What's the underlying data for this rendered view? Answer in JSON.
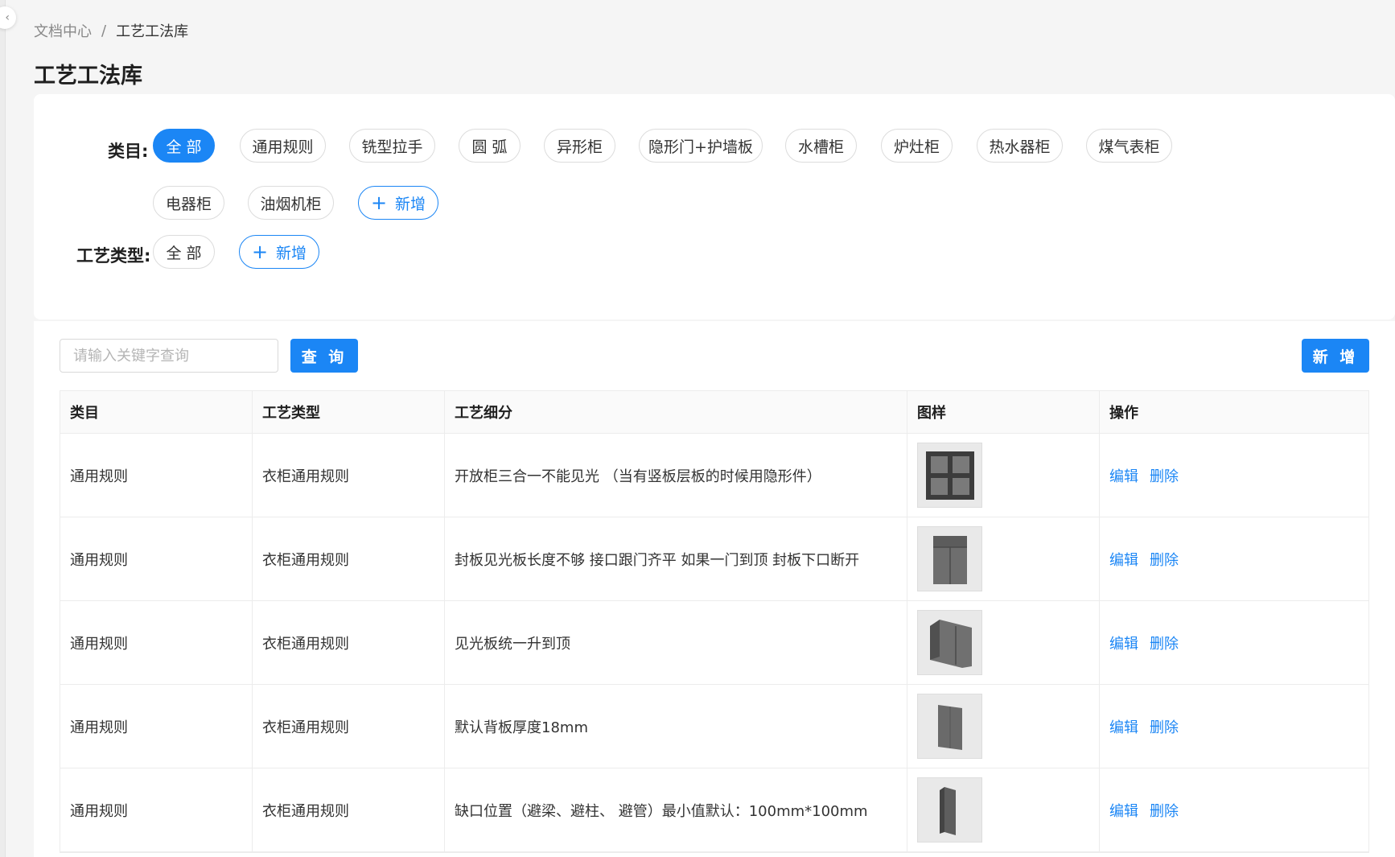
{
  "breadcrumb": {
    "root": "文档中心",
    "separator": "/",
    "current": "工艺工法库"
  },
  "page_title": "工艺工法库",
  "filters": {
    "category_label": "类目:",
    "categories": [
      "全 部",
      "通用规则",
      "铣型拉手",
      "圆 弧",
      "异形柜",
      "隐形门+护墙板",
      "水槽柜",
      "炉灶柜",
      "热水器柜",
      "煤气表柜",
      "电器柜",
      "油烟机柜"
    ],
    "category_add": "新增",
    "type_label": "工艺类型:",
    "types": [
      "全 部"
    ],
    "type_add": "新增"
  },
  "search": {
    "placeholder": "请输入关键字查询",
    "query_button": "查 询",
    "add_button": "新 增"
  },
  "table": {
    "columns": [
      "类目",
      "工艺类型",
      "工艺细分",
      "图样",
      "操作"
    ],
    "rows": [
      {
        "category": "通用规则",
        "type": "衣柜通用规则",
        "detail": "开放柜三合一不能见光 （当有竖板层板的时候用隐形件）",
        "image": "open-cabinet",
        "edit": "编辑",
        "delete": "删除"
      },
      {
        "category": "通用规则",
        "type": "衣柜通用规则",
        "detail": "封板见光板长度不够 接口跟门齐平 如果一门到顶 封板下口断开",
        "image": "tall-wardrobe",
        "edit": "编辑",
        "delete": "删除"
      },
      {
        "category": "通用规则",
        "type": "衣柜通用规则",
        "detail": "见光板统一升到顶",
        "image": "side-panel-cabinet",
        "edit": "编辑",
        "delete": "删除"
      },
      {
        "category": "通用规则",
        "type": "衣柜通用规则",
        "detail": "默认背板厚度18mm",
        "image": "back-panel",
        "edit": "编辑",
        "delete": "删除"
      },
      {
        "category": "通用规则",
        "type": "衣柜通用规则",
        "detail": "缺口位置（避梁、避柱、 避管）最小值默认：100mm*100mm",
        "image": "notched-panel",
        "edit": "编辑",
        "delete": "删除"
      }
    ]
  },
  "colors": {
    "accent": "#1b86f5"
  }
}
